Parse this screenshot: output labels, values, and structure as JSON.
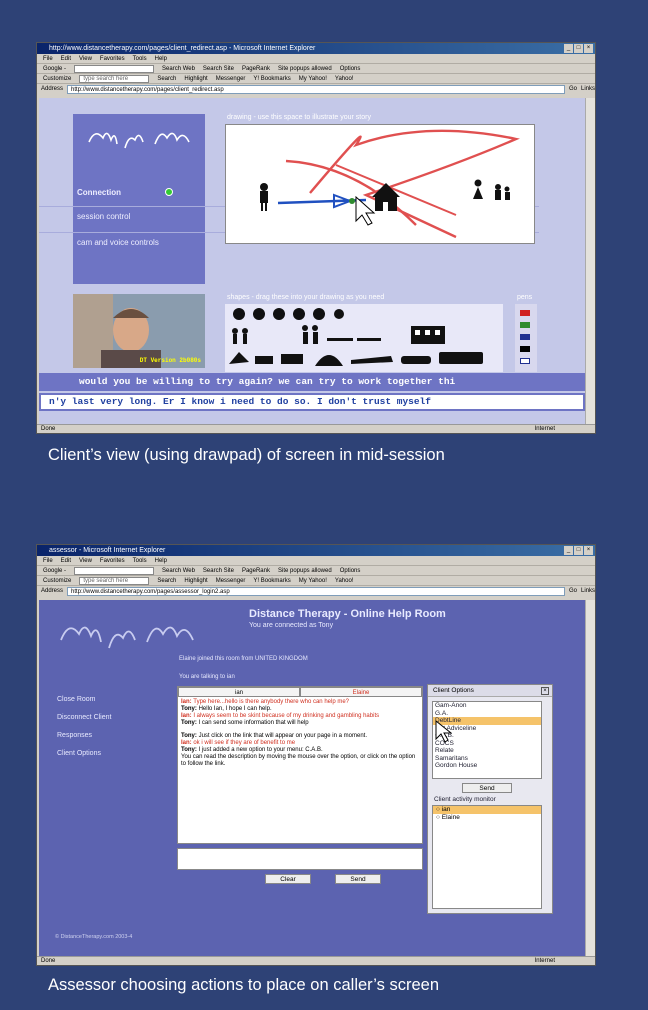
{
  "screenshot1": {
    "window_title": "http://www.distancetherapy.com/pages/client_redirect.asp - Microsoft Internet Explorer",
    "menu": [
      "File",
      "Edit",
      "View",
      "Favorites",
      "Tools",
      "Help"
    ],
    "toolbar1": [
      "Google -",
      "Search Web",
      "Search Site",
      "PageRank",
      "Site popups allowed",
      "Options"
    ],
    "toolbar2": [
      "Customize",
      "type search here",
      "Search",
      "Highlight",
      "Messenger",
      "Y! Bookmarks",
      "My Yahoo!",
      "Yahoo!"
    ],
    "address_label": "Address",
    "address": "http://www.distancetherapy.com/pages/client_redirect.asp",
    "go": "Go",
    "links": "Links",
    "nav": {
      "connection": "Connection",
      "session": "session control",
      "cam": "cam and voice controls"
    },
    "drawing_title": "drawing - use this space to illustrate your story",
    "shapes_title": "shapes - drag these into your drawing as you need",
    "pens_title": "pens",
    "pen_colors": [
      "#d02020",
      "#2e8b2e",
      "#203090",
      "#000000",
      "#ffffff"
    ],
    "webcam_label": "DT Version 2b080s",
    "marquee": "would you be willing to try again? we can try to work together thi",
    "typed": "n'y last very long.  Er I know i need to do so. I don't trust myself",
    "status_left": "Done",
    "status_right": "Internet"
  },
  "caption1": "Client’s view (using drawpad) of screen in mid-session",
  "screenshot2": {
    "window_title": "assessor - Microsoft Internet Explorer",
    "menu": [
      "File",
      "Edit",
      "View",
      "Favorites",
      "Tools",
      "Help"
    ],
    "toolbar1": [
      "Google -",
      "Search Web",
      "Search Site",
      "PageRank",
      "Site popups allowed",
      "Options"
    ],
    "toolbar2": [
      "Customize",
      "type search here",
      "Search",
      "Highlight",
      "Messenger",
      "Y! Bookmarks",
      "My Yahoo!",
      "Yahoo!"
    ],
    "address_label": "Address",
    "address": "http://www.distancetherapy.com/pages/assessor_login2.asp",
    "go": "Go",
    "links": "Links",
    "heading": "Distance Therapy - Online Help Room",
    "connected": "You are connected as Tony",
    "sidebar": [
      "Close Room",
      "Disconnect Client",
      "Responses",
      "Client Options"
    ],
    "joined": "Elaine joined this room from UNITED KINGDOM",
    "talking": "You are talking to ian",
    "tabs": [
      "ian",
      "Elaine"
    ],
    "messages": [
      {
        "who": "Ian:",
        "text": "Type here...hello is there anybody there who can help me?",
        "client": true
      },
      {
        "who": "Tony:",
        "text": "Hello Ian, I hope I can help.",
        "client": false
      },
      {
        "who": "Ian:",
        "text": "I always seem to be skint because of my drinking and gambling habits",
        "client": true
      },
      {
        "who": "Tony:",
        "text": "I can send some information that will help",
        "client": false
      },
      {
        "who": "Tony:",
        "text": "Just click on the link that will appear on your page in a moment.",
        "client": false
      },
      {
        "who": "Ian:",
        "text": "ok i will see if they are of benefit to me",
        "client": true
      },
      {
        "who": "Tony:",
        "text": "I just added a new option to your menu: C.A.B.",
        "client": false
      },
      {
        "who": "",
        "text": "You can read the description by moving the mouse over the option, or click on the option to follow the link.",
        "client": false
      }
    ],
    "clear": "Clear",
    "send": "Send",
    "options_title": "Client Options",
    "options": [
      "Gam-Anon",
      "G.A.",
      "DebtLine",
      "Nat Adviceline",
      "C.A.B.",
      "COCS",
      "Relate",
      "Samaritans",
      "Gordon House"
    ],
    "options_selected": 2,
    "options_send": "Send",
    "monitor_label": "Client activity monitor",
    "monitor": [
      "ian",
      "Elaine"
    ],
    "copyright": "© DistanceTherapy.com 2003-4",
    "status_left": "Done",
    "status_right": "Internet"
  },
  "caption2": "Assessor choosing actions to place on caller’s screen"
}
